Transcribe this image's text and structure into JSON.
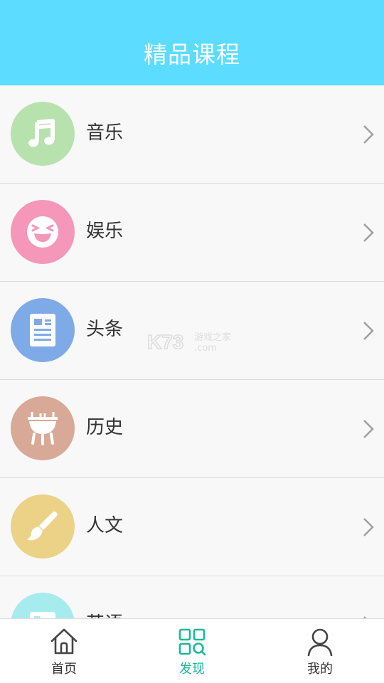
{
  "header": {
    "title": "精品课程",
    "color": "#5cdcff"
  },
  "list": {
    "items": [
      {
        "label": "音乐",
        "icon": "music-note-icon",
        "color": "#b7e2ae"
      },
      {
        "label": "娱乐",
        "icon": "laughing-face-icon",
        "color": "#f497b8"
      },
      {
        "label": "头条",
        "icon": "news-document-icon",
        "color": "#7eaae7"
      },
      {
        "label": "历史",
        "icon": "bronze-vessel-icon",
        "color": "#d8a996"
      },
      {
        "label": "人文",
        "icon": "paint-brush-icon",
        "color": "#ebd286"
      },
      {
        "label": "英语",
        "icon": "english-icon",
        "color": "#a6ebee"
      }
    ]
  },
  "watermark": {
    "brand": "K73",
    "text": "游戏之家",
    "domain": ".com"
  },
  "tabbar": {
    "tabs": [
      {
        "label": "首页",
        "icon": "home-icon",
        "active": false
      },
      {
        "label": "发现",
        "icon": "discover-grid-icon",
        "active": true
      },
      {
        "label": "我的",
        "icon": "user-icon",
        "active": false
      }
    ],
    "active_color": "#19b99a"
  }
}
